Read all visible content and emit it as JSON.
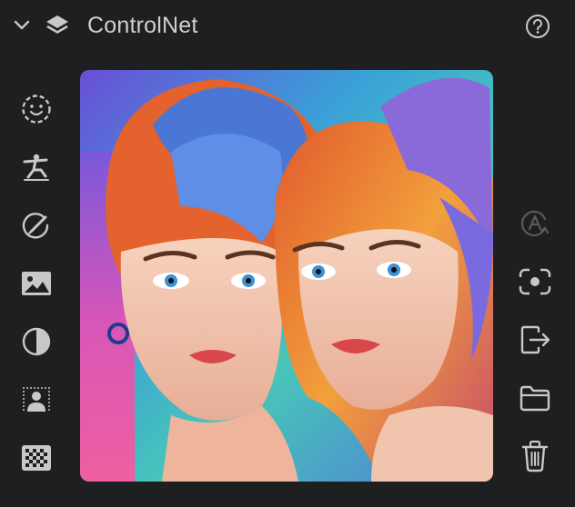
{
  "panel": {
    "title": "ControlNet",
    "icons": {
      "collapse": "chevron-down-icon",
      "layers": "layers-icon",
      "help": "help-circle-icon"
    }
  },
  "left_tools": [
    {
      "name": "face-tool",
      "icon": "smiley-face-icon"
    },
    {
      "name": "pose-tool",
      "icon": "pose-figure-icon"
    },
    {
      "name": "scribble-tool",
      "icon": "pencil-circle-icon"
    },
    {
      "name": "image-tool",
      "icon": "image-icon"
    },
    {
      "name": "contrast-tool",
      "icon": "half-circle-contrast-icon"
    },
    {
      "name": "person-mask-tool",
      "icon": "person-dotted-icon"
    },
    {
      "name": "transparency-tool",
      "icon": "checkerboard-icon"
    }
  ],
  "right_tools": [
    {
      "name": "auto-button",
      "icon": "auto-a-icon",
      "state": "disabled"
    },
    {
      "name": "focus-button",
      "icon": "focus-frame-icon"
    },
    {
      "name": "export-button",
      "icon": "export-arrow-icon"
    },
    {
      "name": "open-folder-button",
      "icon": "folder-icon"
    },
    {
      "name": "delete-button",
      "icon": "trash-icon"
    }
  ],
  "colors": {
    "background": "#1e1f20",
    "icon": "#c8c8c8",
    "icon_disabled": "#5a5a5a",
    "title": "#cfcfcf"
  }
}
